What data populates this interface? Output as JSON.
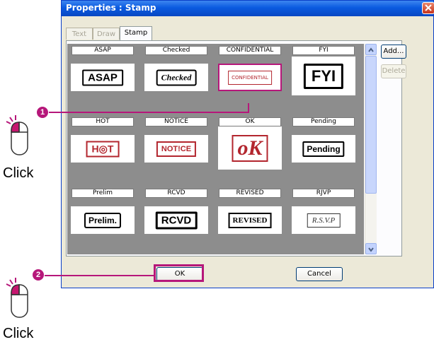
{
  "dialog": {
    "title": "Properties : Stamp",
    "tabs": [
      {
        "label": "Text",
        "active": false
      },
      {
        "label": "Draw",
        "active": false
      },
      {
        "label": "Stamp",
        "active": true
      }
    ],
    "buttons": {
      "add": "Add...",
      "delete": "Delete",
      "ok": "OK",
      "cancel": "Cancel"
    }
  },
  "stamps": [
    {
      "label": "ASAP",
      "art": "ASAP",
      "selected": false
    },
    {
      "label": "Checked",
      "art": "Checked",
      "selected": false
    },
    {
      "label": "CONFIDENTIAL",
      "art": "CONFIDENTIAL",
      "selected": true
    },
    {
      "label": "FYI",
      "art": "FYI",
      "selected": false
    },
    {
      "label": "HOT",
      "art": "H◎T",
      "selected": false
    },
    {
      "label": "NOTICE",
      "art": "NOT!CE",
      "selected": false
    },
    {
      "label": "OK",
      "art": "oK",
      "selected": false
    },
    {
      "label": "Pending",
      "art": "Pending",
      "selected": false
    },
    {
      "label": "Prelim",
      "art": "Prelim.",
      "selected": false
    },
    {
      "label": "RCVD",
      "art": "RCVD",
      "selected": false
    },
    {
      "label": "REVISED",
      "art": "REVISED",
      "selected": false
    },
    {
      "label": "RJVP",
      "art": "R.S.V.P",
      "selected": false
    }
  ],
  "annotations": {
    "step1": "1",
    "step2": "2",
    "click1": "Click",
    "click2": "Click"
  },
  "colors": {
    "accent": "#b6177a",
    "stamp_red": "#b3262e",
    "title_blue": "#0a5ae0"
  }
}
